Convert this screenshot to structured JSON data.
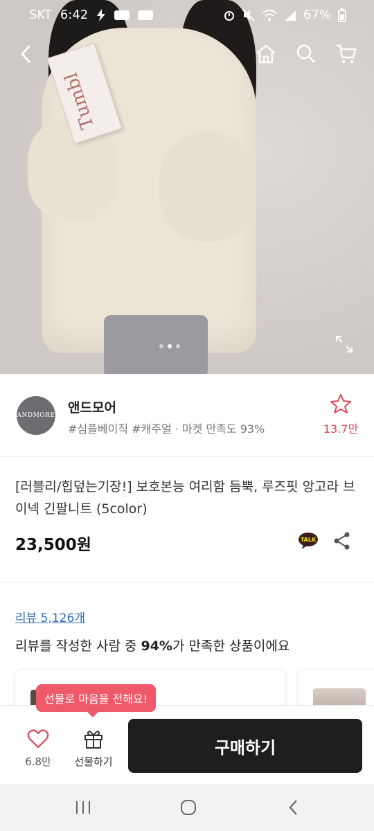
{
  "status_bar": {
    "carrier": "SKT",
    "time": "6:42",
    "battery": "67%"
  },
  "hero": {
    "box_text": "Tumbl",
    "image_index": 1,
    "image_count": 3
  },
  "seller": {
    "logo_text": "ANDMORE",
    "name": "앤드모어",
    "tags": "#심플베이직 #캐주얼 · 마켓 만족도 93%",
    "favorite_count": "13.7만"
  },
  "product": {
    "title": "[러블리/힙덮는기장!] 보호본능 여리함 듬뿍, 루즈핏 앙고라 브이넥 긴팔니트 (5color)",
    "price": "23,500원",
    "talk_label": "TALK"
  },
  "review": {
    "link": "리뷰 5,126개",
    "summary_prefix": "리뷰를 작성한 사람 중 ",
    "summary_highlight": "94%",
    "summary_suffix": "가 만족한 상품이에요"
  },
  "action_bar": {
    "like_count": "6.8만",
    "gift_label": "선물하기",
    "buy_label": "구매하기",
    "tooltip": "선물로 마음을 전해요!"
  },
  "colors": {
    "accent_red": "#e04458",
    "tooltip_bg": "#ef5a6a",
    "buy_button": "#1e1e1e",
    "link_blue": "#2f6cb5"
  }
}
